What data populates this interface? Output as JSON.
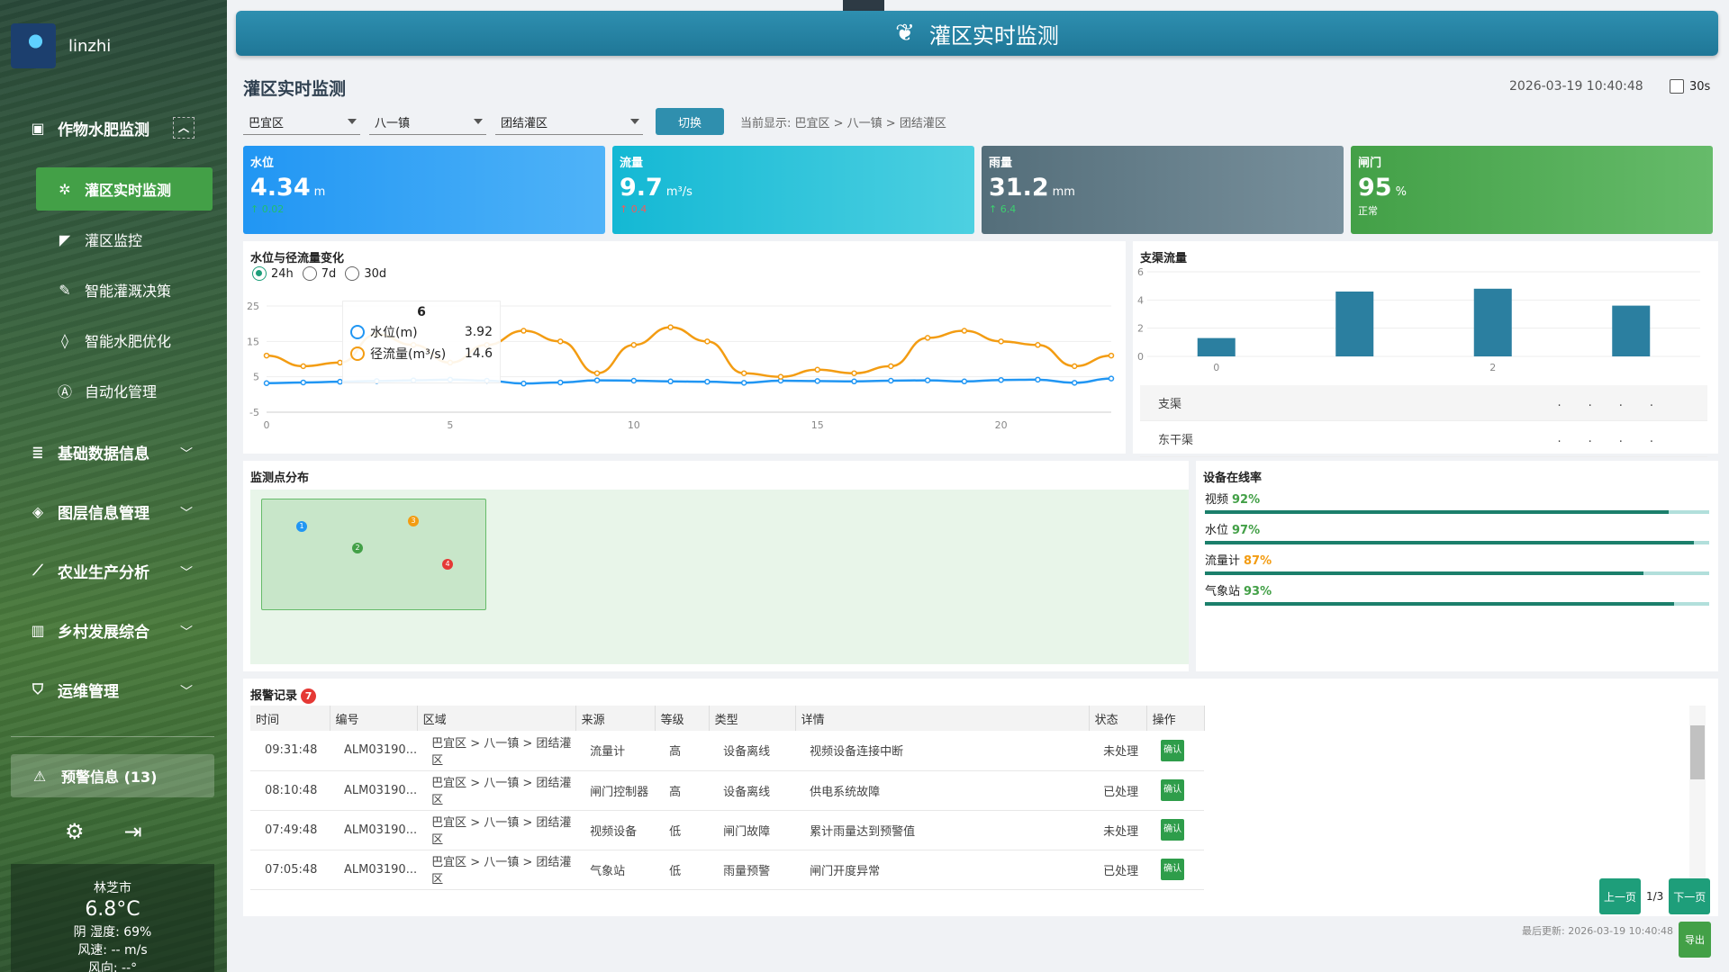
{
  "user": {
    "name": "linzhi"
  },
  "sidebar": {
    "groups": [
      {
        "label": "作物水肥监测",
        "icon": "monitor-icon"
      },
      {
        "label": "基础数据信息",
        "icon": "database-icon"
      },
      {
        "label": "图层信息管理",
        "icon": "layers-icon"
      },
      {
        "label": "农业生产分析",
        "icon": "chart-line-icon"
      },
      {
        "label": "乡村发展综合",
        "icon": "buildings-icon"
      },
      {
        "label": "运维管理",
        "icon": "shield-icon"
      }
    ],
    "subitems": [
      {
        "label": "灌区实时监测",
        "icon": "aperture-icon"
      },
      {
        "label": "灌区监控",
        "icon": "camera-icon"
      },
      {
        "label": "智能灌溉决策",
        "icon": "edit-icon"
      },
      {
        "label": "智能水肥优化",
        "icon": "drop-icon"
      },
      {
        "label": "自动化管理",
        "icon": "auto-icon"
      }
    ],
    "alert_label": "预警信息 (13)"
  },
  "weather": {
    "city": "林芝市",
    "temp": "6.8°C",
    "cond": "阴 湿度: 69%",
    "wind": "风速: -- m/s",
    "dir": "风向: --°"
  },
  "header": {
    "title": "灌区实时监测",
    "page_title": "灌区实时监测",
    "timestamp": "2026-03-19 10:40:48",
    "auto_label": "30s"
  },
  "filters": {
    "region": "巴宜区",
    "town": "八一镇",
    "district": "团结灌区",
    "switch_label": "切换",
    "current": "当前显示: 巴宜区 > 八一镇 > 团结灌区"
  },
  "cards": [
    {
      "label": "水位",
      "value": "4.34",
      "unit": "m",
      "sub": "↑ 0.02"
    },
    {
      "label": "流量",
      "value": "9.7",
      "unit": "m³/s",
      "sub": "↑ 0.4"
    },
    {
      "label": "雨量",
      "value": "31.2",
      "unit": "mm",
      "sub": "↑ 6.4"
    },
    {
      "label": "闸门",
      "value": "95",
      "unit": "%",
      "sub": "正常"
    }
  ],
  "colors": {
    "water": "#2196f3",
    "flow": "#f39c12",
    "bar": "#2b7fa0"
  },
  "line_panel": {
    "title": "水位与径流量变化",
    "ranges": [
      "24h",
      "7d",
      "30d"
    ],
    "tooltip": {
      "title": "6",
      "s1": "水位(m)",
      "v1": "3.92",
      "s2": "径流量(m³/s)",
      "v2": "14.6"
    }
  },
  "bar_panel": {
    "title": "支渠流量",
    "list": [
      {
        "name": "支渠",
        "dots": "...."
      },
      {
        "name": "东干渠",
        "dots": "...."
      }
    ]
  },
  "chart_data": [
    {
      "type": "line",
      "title": "水位与径流量变化",
      "x": [
        0,
        1,
        2,
        3,
        4,
        5,
        6,
        7,
        8,
        9,
        10,
        11,
        12,
        13,
        14,
        15,
        16,
        17,
        18,
        19,
        20,
        21,
        22,
        23
      ],
      "xticks": [
        0,
        5,
        10,
        15,
        20
      ],
      "ylim": [
        -5,
        25
      ],
      "yticks": [
        -5,
        5,
        15,
        25
      ],
      "series": [
        {
          "name": "水位(m)",
          "values": [
            3.2,
            3.4,
            3.6,
            3.8,
            4.0,
            4.2,
            3.9,
            3.1,
            3.4,
            4.0,
            3.9,
            3.7,
            3.6,
            3.3,
            3.9,
            3.8,
            3.7,
            3.9,
            4.0,
            3.7,
            4.1,
            4.2,
            3.3,
            4.5
          ]
        },
        {
          "name": "径流量(m³/s)",
          "values": [
            11,
            8,
            9,
            17,
            14,
            9,
            14,
            18,
            15,
            6,
            14,
            19,
            15,
            6,
            5,
            7,
            6,
            8,
            16,
            18,
            15,
            14,
            8,
            11
          ]
        }
      ]
    },
    {
      "type": "bar",
      "title": "支渠流量",
      "categories": [
        "0",
        "1",
        "2",
        "3"
      ],
      "xticks": [
        "0",
        "",
        "2",
        ""
      ],
      "values": [
        1.3,
        4.6,
        4.8,
        3.6
      ],
      "ylim": [
        0,
        6
      ],
      "yticks": [
        0,
        2,
        4,
        6
      ]
    }
  ],
  "map": {
    "title": "监测点分布",
    "pins": [
      "1",
      "2",
      "3",
      "4"
    ]
  },
  "online": {
    "title": "设备在线率",
    "items": [
      {
        "name": "视频",
        "pct": "92%",
        "value": 0.92,
        "color": "#43a047"
      },
      {
        "name": "水位",
        "pct": "97%",
        "value": 0.97,
        "color": "#43a047"
      },
      {
        "name": "流量计",
        "pct": "87%",
        "value": 0.87,
        "color": "#f39c12"
      },
      {
        "name": "气象站",
        "pct": "93%",
        "value": 0.93,
        "color": "#43a047"
      }
    ]
  },
  "alerts": {
    "title": "报警记录",
    "count": "7",
    "headers": [
      "时间",
      "编号",
      "区域",
      "来源",
      "等级",
      "类型",
      "详情",
      "状态",
      "操作"
    ],
    "rows": [
      [
        "09:31:48",
        "ALM03190...",
        "巴宜区 > 八一镇 > 团结灌区",
        "流量计",
        "高",
        "设备离线",
        "视频设备连接中断",
        "未处理",
        "确认"
      ],
      [
        "08:10:48",
        "ALM03190...",
        "巴宜区 > 八一镇 > 团结灌区",
        "闸门控制器",
        "高",
        "设备离线",
        "供电系统故障",
        "已处理",
        "确认"
      ],
      [
        "07:49:48",
        "ALM03190...",
        "巴宜区 > 八一镇 > 团结灌区",
        "视频设备",
        "低",
        "闸门故障",
        "累计雨量达到预警值",
        "未处理",
        "确认"
      ],
      [
        "07:05:48",
        "ALM03190...",
        "巴宜区 > 八一镇 > 团结灌区",
        "气象站",
        "低",
        "雨量预警",
        "闸门开度异常",
        "已处理",
        "确认"
      ]
    ],
    "prev": "上一页",
    "page": "1/3",
    "next": "下一页",
    "updated": "最后更新: 2026-03-19 10:40:48",
    "export": "导出"
  }
}
